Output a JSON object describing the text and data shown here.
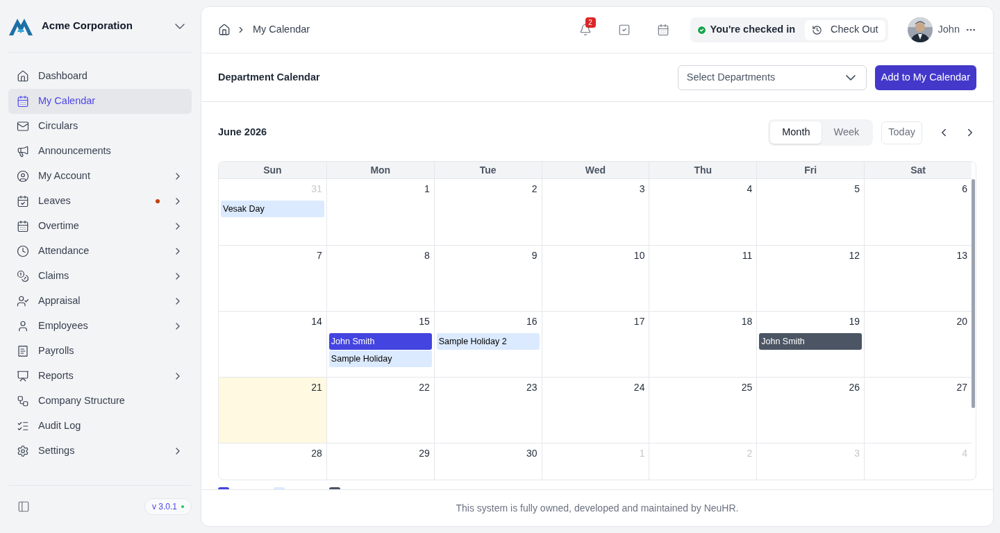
{
  "sidebar": {
    "company": "Acme Corporation",
    "items": [
      {
        "label": "Dashboard",
        "selected": false,
        "expandable": false,
        "dot": false
      },
      {
        "label": "My Calendar",
        "selected": true,
        "expandable": false,
        "dot": false
      },
      {
        "label": "Circulars",
        "selected": false,
        "expandable": false,
        "dot": false
      },
      {
        "label": "Announcements",
        "selected": false,
        "expandable": false,
        "dot": false
      },
      {
        "label": "My Account",
        "selected": false,
        "expandable": true,
        "dot": false
      },
      {
        "label": "Leaves",
        "selected": false,
        "expandable": true,
        "dot": true
      },
      {
        "label": "Overtime",
        "selected": false,
        "expandable": true,
        "dot": false
      },
      {
        "label": "Attendance",
        "selected": false,
        "expandable": true,
        "dot": false
      },
      {
        "label": "Claims",
        "selected": false,
        "expandable": true,
        "dot": false
      },
      {
        "label": "Appraisal",
        "selected": false,
        "expandable": true,
        "dot": false
      },
      {
        "label": "Employees",
        "selected": false,
        "expandable": true,
        "dot": false
      },
      {
        "label": "Payrolls",
        "selected": false,
        "expandable": false,
        "dot": false
      },
      {
        "label": "Reports",
        "selected": false,
        "expandable": true,
        "dot": false
      },
      {
        "label": "Company Structure",
        "selected": false,
        "expandable": false,
        "dot": false
      },
      {
        "label": "Audit Log",
        "selected": false,
        "expandable": false,
        "dot": false
      },
      {
        "label": "Settings",
        "selected": false,
        "expandable": true,
        "dot": false
      }
    ],
    "version": "v 3.0.1"
  },
  "header": {
    "breadcrumb": "My Calendar",
    "notification_count": "2",
    "status": "You're checked in",
    "check_out": "Check Out",
    "user": "John"
  },
  "section": {
    "title": "Department Calendar",
    "select_placeholder": "Select Departments",
    "add_button": "Add to My Calendar"
  },
  "calendar": {
    "month": "June 2026",
    "views": [
      {
        "label": "Month",
        "selected": true
      },
      {
        "label": "Week",
        "selected": false
      }
    ],
    "today_button": "Today",
    "weekdays": [
      "Sun",
      "Mon",
      "Tue",
      "Wed",
      "Thu",
      "Fri",
      "Sat"
    ],
    "weeks": [
      [
        {
          "day": "31",
          "muted": true,
          "today": false,
          "events": [
            {
              "title": "Vesak Day",
              "kind": "holiday"
            }
          ]
        },
        {
          "day": "1",
          "muted": false,
          "today": false
        },
        {
          "day": "2",
          "muted": false,
          "today": false
        },
        {
          "day": "3",
          "muted": false,
          "today": false
        },
        {
          "day": "4",
          "muted": false,
          "today": false
        },
        {
          "day": "5",
          "muted": false,
          "today": false
        },
        {
          "day": "6",
          "muted": false,
          "today": false
        }
      ],
      [
        {
          "day": "7",
          "muted": false,
          "today": false
        },
        {
          "day": "8",
          "muted": false,
          "today": false
        },
        {
          "day": "9",
          "muted": false,
          "today": false
        },
        {
          "day": "10",
          "muted": false,
          "today": false
        },
        {
          "day": "11",
          "muted": false,
          "today": false
        },
        {
          "day": "12",
          "muted": false,
          "today": false
        },
        {
          "day": "13",
          "muted": false,
          "today": false
        }
      ],
      [
        {
          "day": "14",
          "muted": false,
          "today": false
        },
        {
          "day": "15",
          "muted": false,
          "today": false,
          "events": [
            {
              "title": "John Smith",
              "kind": "leave"
            },
            {
              "title": "Sample Holiday",
              "kind": "holiday"
            }
          ]
        },
        {
          "day": "16",
          "muted": false,
          "today": false,
          "events": [
            {
              "title": "Sample Holiday 2",
              "kind": "holiday"
            }
          ]
        },
        {
          "day": "17",
          "muted": false,
          "today": false
        },
        {
          "day": "18",
          "muted": false,
          "today": false
        },
        {
          "day": "19",
          "muted": false,
          "today": false,
          "events": [
            {
              "title": "John Smith",
              "kind": "deadline"
            }
          ]
        },
        {
          "day": "20",
          "muted": false,
          "today": false
        }
      ],
      [
        {
          "day": "21",
          "muted": false,
          "today": true
        },
        {
          "day": "22",
          "muted": false,
          "today": false
        },
        {
          "day": "23",
          "muted": false,
          "today": false
        },
        {
          "day": "24",
          "muted": false,
          "today": false
        },
        {
          "day": "25",
          "muted": false,
          "today": false
        },
        {
          "day": "26",
          "muted": false,
          "today": false
        },
        {
          "day": "27",
          "muted": false,
          "today": false
        }
      ],
      [
        {
          "day": "28",
          "muted": false,
          "today": false
        },
        {
          "day": "29",
          "muted": false,
          "today": false
        },
        {
          "day": "30",
          "muted": false,
          "today": false
        },
        {
          "day": "1",
          "muted": true,
          "today": false
        },
        {
          "day": "2",
          "muted": true,
          "today": false
        },
        {
          "day": "3",
          "muted": true,
          "today": false
        },
        {
          "day": "4",
          "muted": true,
          "today": false
        }
      ]
    ],
    "legend": [
      {
        "color": "#4444e0"
      },
      {
        "color": "#dbeafe"
      },
      {
        "color": "#4b5563"
      }
    ]
  },
  "footer": "This system is fully owned, developed and maintained by NeuHR."
}
